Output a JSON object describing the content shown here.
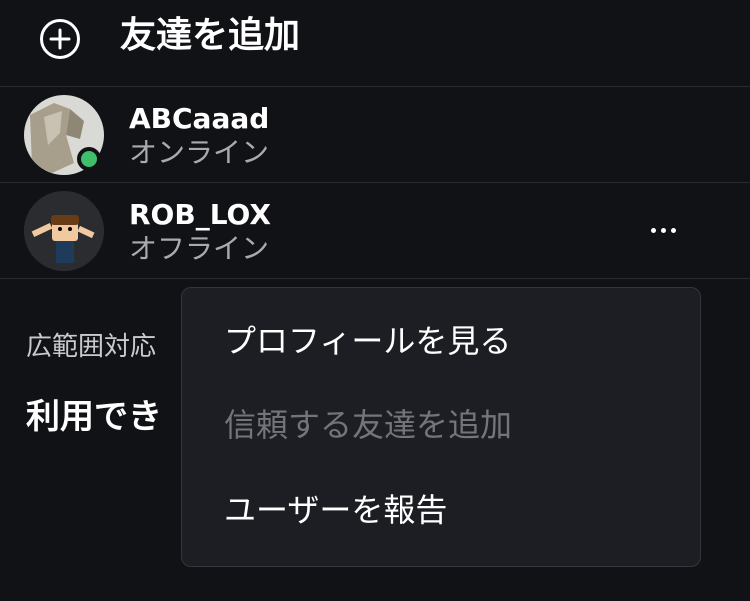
{
  "header": {
    "add_icon": "plus-circle-icon",
    "title": "友達を追加"
  },
  "friends": [
    {
      "name": "ABCaaad",
      "status": "オンライン",
      "online": true,
      "status_color": "#3fbf6a"
    },
    {
      "name": "ROB_LOX",
      "status": "オフライン",
      "online": false
    }
  ],
  "more_icon": "ellipsis-icon",
  "section": {
    "label": "広範囲対応",
    "heading": "利用でき"
  },
  "context_menu": {
    "items": [
      {
        "label": "プロフィールを見る",
        "enabled": true
      },
      {
        "label": "信頼する友達を追加",
        "enabled": false
      },
      {
        "label": "ユーザーを報告",
        "enabled": true
      }
    ]
  },
  "colors": {
    "background": "#111216",
    "menu_background": "#1d1e23",
    "divider": "#2a2c32",
    "secondary_text": "#a9aab0",
    "disabled_text": "#74757b"
  }
}
